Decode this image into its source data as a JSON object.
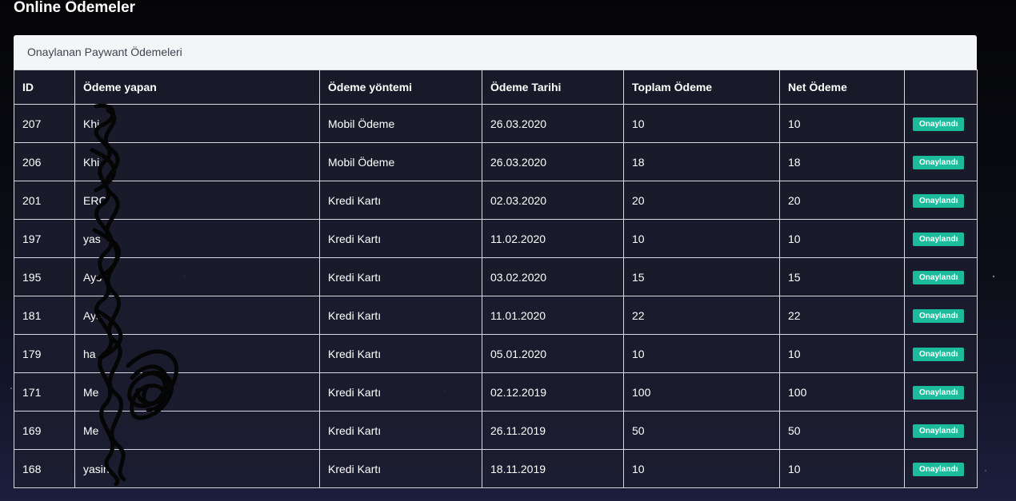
{
  "page": {
    "title": "Online Ödemeler"
  },
  "card": {
    "header": "Onaylanan Paywant Ödemeleri"
  },
  "table": {
    "columns": [
      "ID",
      "Ödeme yapan",
      "Ödeme yöntemi",
      "Ödeme Tarihi",
      "Toplam Ödeme",
      "Net Ödeme",
      ""
    ],
    "rows": [
      {
        "id": "207",
        "payer": "Khi",
        "method": "Mobil Ödeme",
        "date": "26.03.2020",
        "total": "10",
        "net": "10",
        "status": "Onaylandı"
      },
      {
        "id": "206",
        "payer": "Khi",
        "method": "Mobil Ödeme",
        "date": "26.03.2020",
        "total": "18",
        "net": "18",
        "status": "Onaylandı"
      },
      {
        "id": "201",
        "payer": "ERC",
        "method": "Kredi Kartı",
        "date": "02.03.2020",
        "total": "20",
        "net": "20",
        "status": "Onaylandı"
      },
      {
        "id": "197",
        "payer": "yas",
        "method": "Kredi Kartı",
        "date": "11.02.2020",
        "total": "10",
        "net": "10",
        "status": "Onaylandı"
      },
      {
        "id": "195",
        "payer": "Ays",
        "method": "Kredi Kartı",
        "date": "03.02.2020",
        "total": "15",
        "net": "15",
        "status": "Onaylandı"
      },
      {
        "id": "181",
        "payer": "Ays",
        "method": "Kredi Kartı",
        "date": "11.01.2020",
        "total": "22",
        "net": "22",
        "status": "Onaylandı"
      },
      {
        "id": "179",
        "payer": "ha",
        "method": "Kredi Kartı",
        "date": "05.01.2020",
        "total": "10",
        "net": "10",
        "status": "Onaylandı"
      },
      {
        "id": "171",
        "payer": "Me",
        "method": "Kredi Kartı",
        "date": "02.12.2019",
        "total": "100",
        "net": "100",
        "status": "Onaylandı"
      },
      {
        "id": "169",
        "payer": "Me",
        "method": "Kredi Kartı",
        "date": "26.11.2019",
        "total": "50",
        "net": "50",
        "status": "Onaylandı"
      },
      {
        "id": "168",
        "payer": "yasin",
        "method": "Kredi Kartı",
        "date": "18.11.2019",
        "total": "10",
        "net": "10",
        "status": "Onaylandı"
      }
    ]
  },
  "colors": {
    "badge": "#1abc9c",
    "header_bg": "#f4f5f6"
  }
}
